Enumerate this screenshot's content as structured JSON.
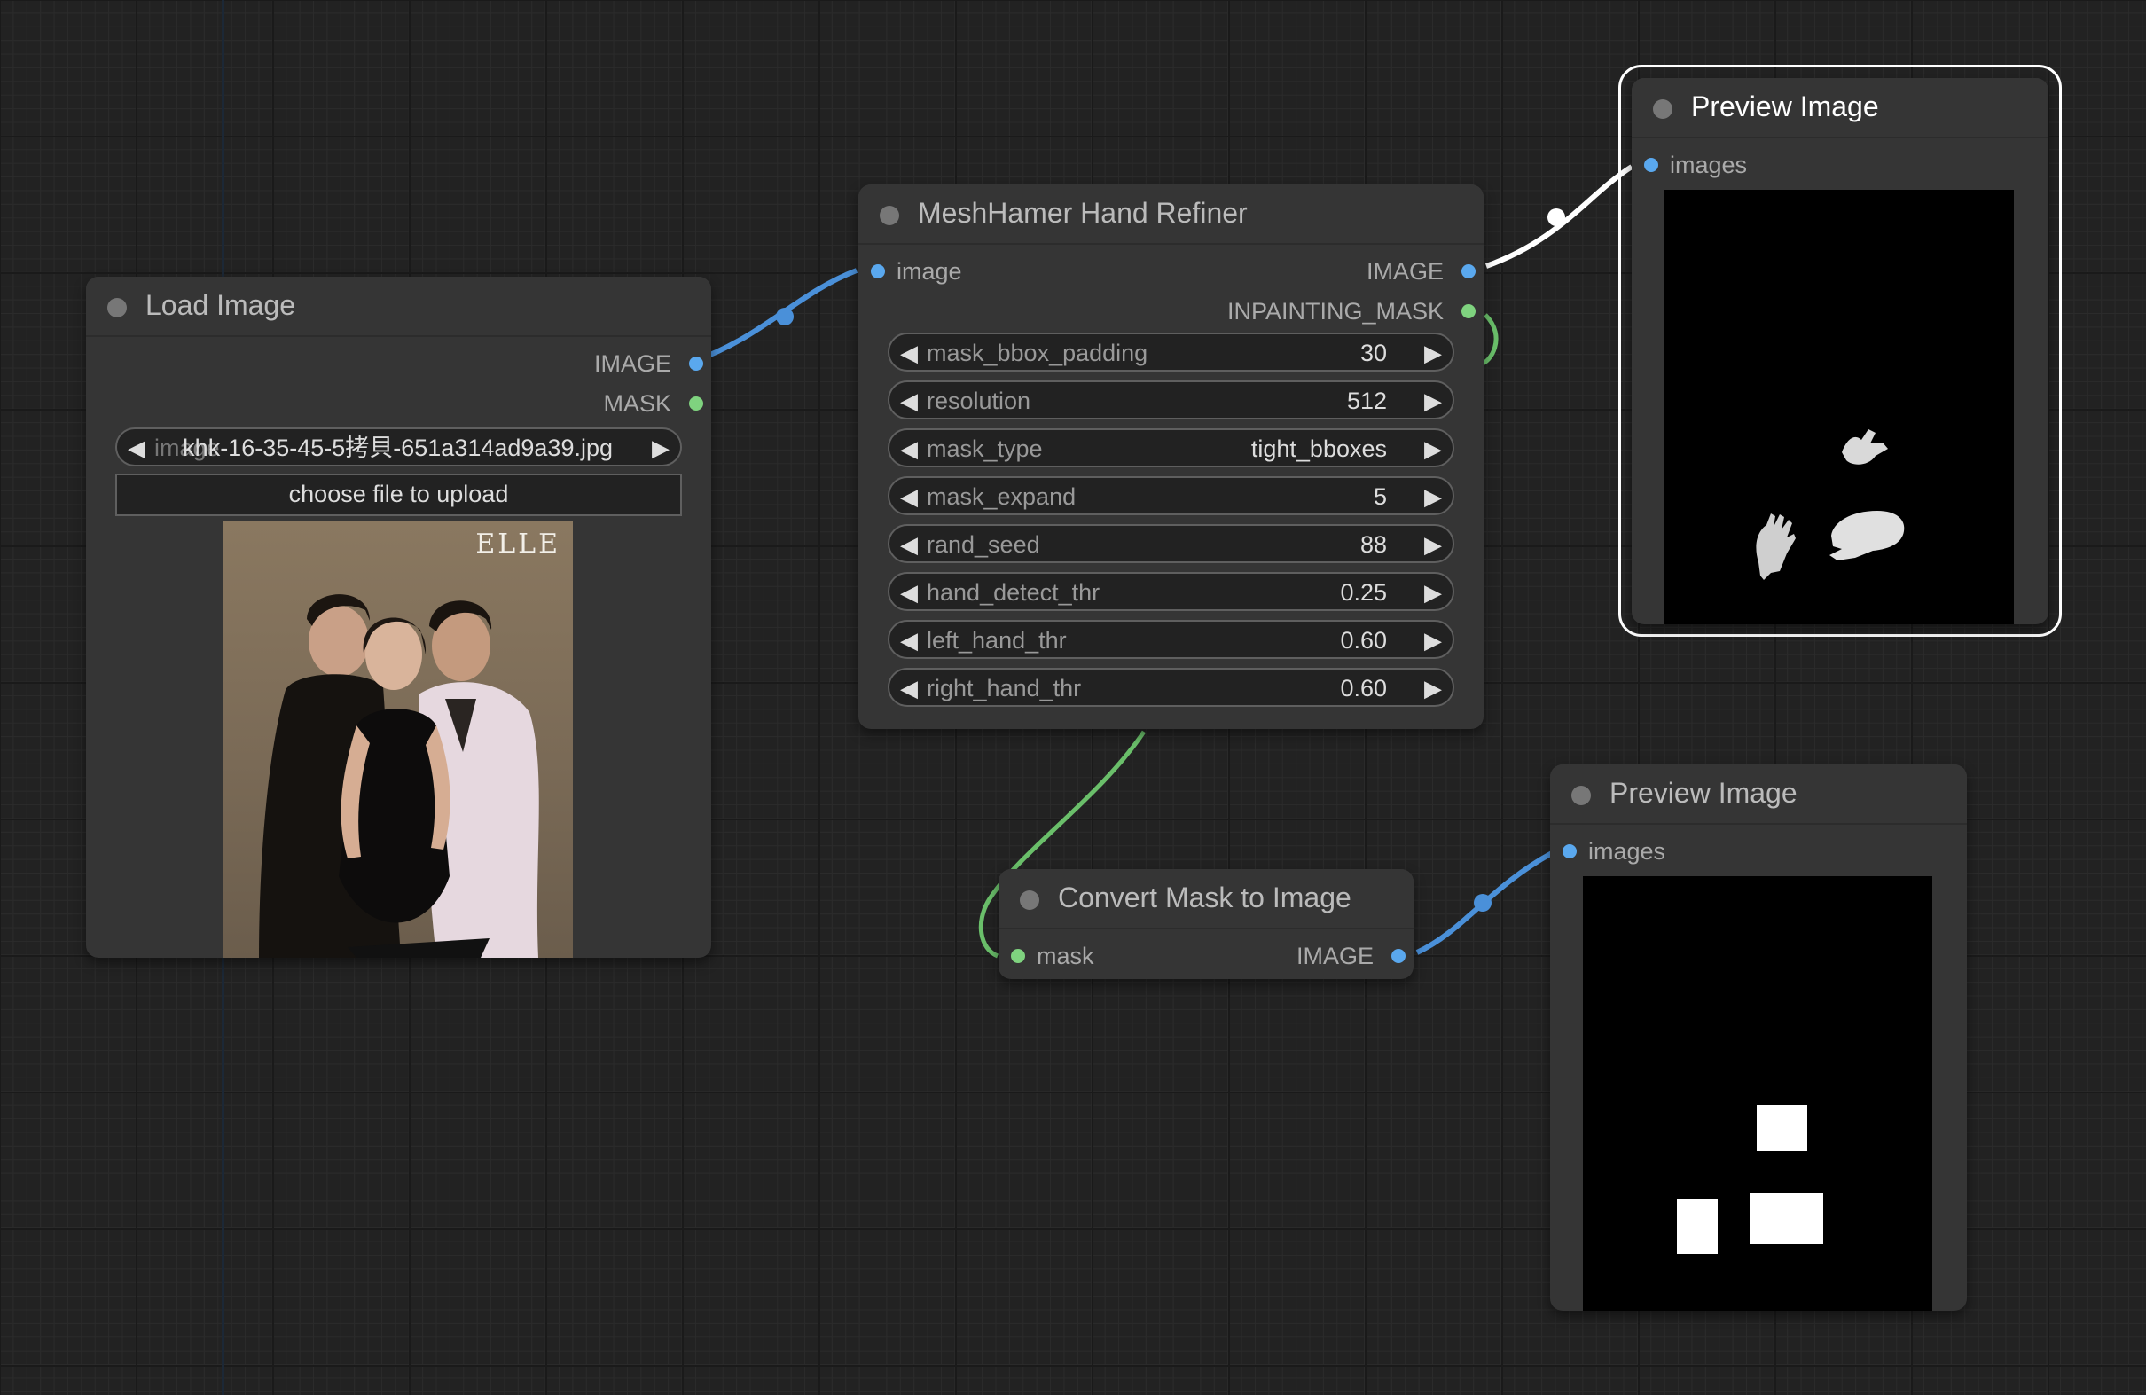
{
  "colors": {
    "canvas_bg": "#222222",
    "node_bg": "#353535",
    "image_slot": "#5aa8ee",
    "mask_slot": "#7fd37f",
    "link_image": "#4a90d9",
    "link_mask": "#6abf6a",
    "link_selected": "#ffffff"
  },
  "load_image": {
    "title": "Load Image",
    "outputs": [
      "IMAGE",
      "MASK"
    ],
    "image_widget": {
      "name": "image",
      "value": "khk-16-35-45-5拷貝-651a314ad9a39.jpg"
    },
    "upload_label": "choose file to upload",
    "preview_watermark": "ELLE"
  },
  "refiner": {
    "title": "MeshHamer Hand Refiner",
    "input": "image",
    "outputs": [
      "IMAGE",
      "INPAINTING_MASK"
    ],
    "widgets": [
      {
        "name": "mask_bbox_padding",
        "value": "30"
      },
      {
        "name": "resolution",
        "value": "512"
      },
      {
        "name": "mask_type",
        "value": "tight_bboxes"
      },
      {
        "name": "mask_expand",
        "value": "5"
      },
      {
        "name": "rand_seed",
        "value": "88"
      },
      {
        "name": "hand_detect_thr",
        "value": "0.25"
      },
      {
        "name": "left_hand_thr",
        "value": "0.60"
      },
      {
        "name": "right_hand_thr",
        "value": "0.60"
      }
    ]
  },
  "preview_top": {
    "title": "Preview Image",
    "input": "images",
    "selected": true
  },
  "preview_bottom": {
    "title": "Preview Image",
    "input": "images"
  },
  "convert": {
    "title": "Convert Mask to Image",
    "input": "mask",
    "output": "IMAGE"
  },
  "icons": {
    "arrow_left": "◀",
    "arrow_right": "▶"
  }
}
